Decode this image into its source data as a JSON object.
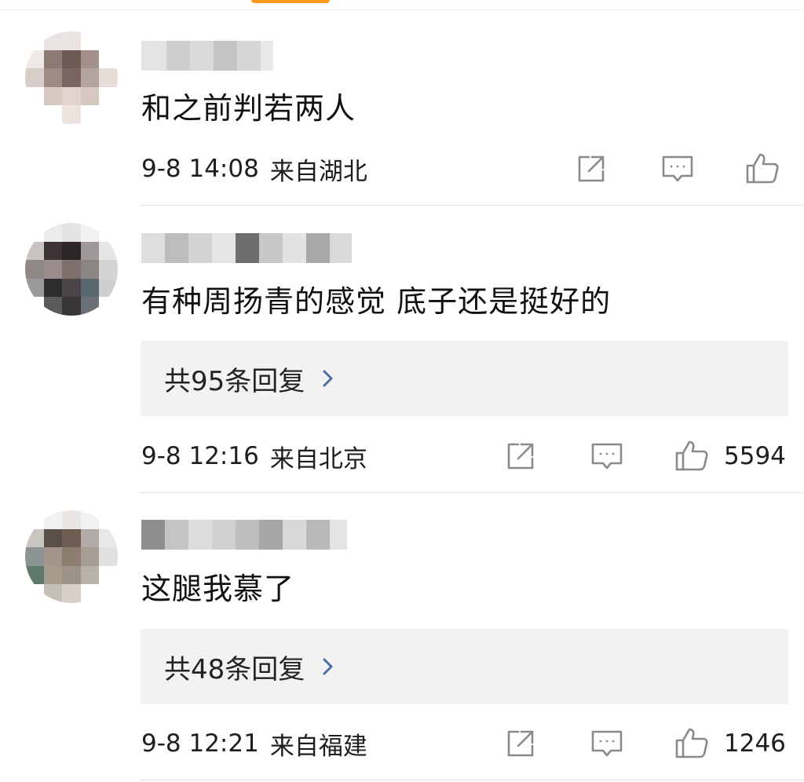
{
  "comments": [
    {
      "content": "和之前判若两人",
      "time": "9-8 14:08",
      "from": "来自湖北",
      "replies_label": "",
      "like_count": ""
    },
    {
      "content": "有种周扬青的感觉 底子还是挺好的",
      "time": "9-8 12:16",
      "from": "来自北京",
      "replies_label": "共95条回复",
      "like_count": "5594"
    },
    {
      "content": "这腿我慕了",
      "time": "9-8 12:21",
      "from": "来自福建",
      "replies_label": "共48条回复",
      "like_count": "1246"
    }
  ],
  "icons": {
    "share": "share-icon",
    "comment": "comment-icon",
    "like": "thumbs-up-icon",
    "reply_arrow": "chevron-right-icon"
  },
  "colors": {
    "accent": "#ff9a1f",
    "reply_box_bg": "#f2f2f2",
    "arrow_blue": "#4a6fa5",
    "icon_gray": "#8a8a8a"
  }
}
